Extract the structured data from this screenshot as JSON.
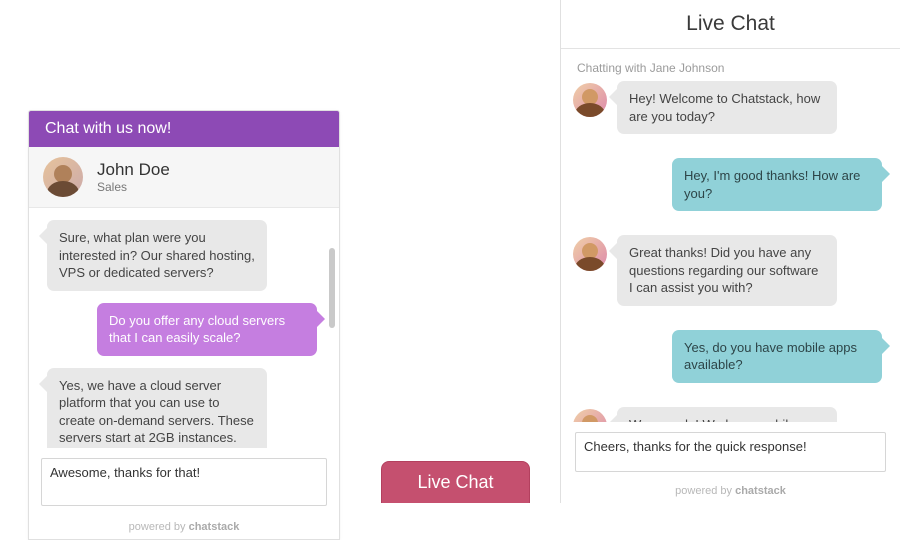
{
  "leftWidget": {
    "headerTitle": "Chat with us now!",
    "agentName": "John Doe",
    "agentRole": "Sales",
    "messages": [
      {
        "side": "op",
        "text": "Sure, what plan were you interested in? Our shared hosting, VPS or dedicated servers?"
      },
      {
        "side": "me",
        "text": "Do you offer any cloud servers that I can easily scale?"
      },
      {
        "side": "op",
        "text": "Yes, we have a cloud server platform that you can use to create on-demand servers. These servers start at 2GB instances."
      }
    ],
    "inputValue": "Awesome, thanks for that!",
    "poweredPrefix": "powered by ",
    "poweredBrand": "chatstack"
  },
  "centerButton": {
    "label": "Live Chat"
  },
  "rightPanel": {
    "title": "Live Chat",
    "subLabel": "Chatting with Jane Johnson",
    "messages": [
      {
        "side": "op",
        "text": "Hey! Welcome to Chatstack, how are you today?"
      },
      {
        "side": "me",
        "text": "Hey, I'm good thanks! How are you?"
      },
      {
        "side": "op",
        "text": "Great thanks! Did you have any questions regarding our software I can assist you with?"
      },
      {
        "side": "me",
        "text": "Yes, do you have mobile apps available?"
      },
      {
        "side": "op",
        "text": "We sure do! We have mobile apps available for both iPhone and Android. These will allow you to chat to your customers while you are relaxing at the beach!"
      }
    ],
    "inputValue": "Cheers, thanks for the quick response!",
    "poweredPrefix": "powered by ",
    "poweredBrand": "chatstack"
  },
  "colors": {
    "purpleHeader": "#8d4ab5",
    "purpleBubble": "#c57ee0",
    "tealBubble": "#90d1d8",
    "redButton": "#c5506f"
  }
}
